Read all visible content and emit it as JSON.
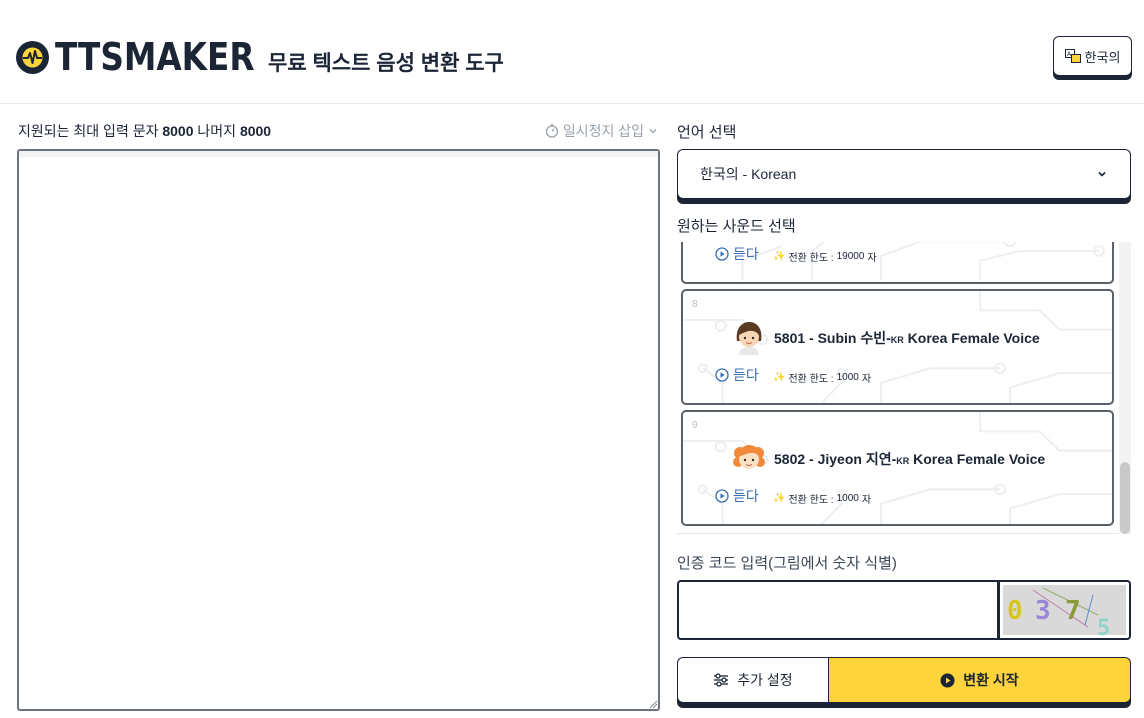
{
  "header": {
    "logo_text": "TTSMAKER",
    "tagline": "무료 텍스트 음성 변환 도구",
    "language_button": "한국의"
  },
  "editor": {
    "stats_prefix": "지원되는 최대 입력 문자",
    "max_chars": "8000",
    "remaining_label": "나머지",
    "remaining_chars": "8000",
    "pause_insert": "일시정지 삽입",
    "text_value": ""
  },
  "language": {
    "label": "언어 선택",
    "selected": "한국의 - Korean"
  },
  "voices": {
    "label": "원하는 사운드 선택",
    "listen_label": "듣다",
    "limit_prefix": "전환 한도 :",
    "limit_unit": "자",
    "items": [
      {
        "index": "",
        "name": "",
        "tag": "",
        "suffix": "",
        "limit": "19000"
      },
      {
        "index": "8",
        "name": "5801 - Subin 수빈-",
        "tag": "KR",
        "suffix": " Korea Female Voice",
        "limit": "1000"
      },
      {
        "index": "9",
        "name": "5802 - Jiyeon 지연-",
        "tag": "KR",
        "suffix": " Korea Female Voice",
        "limit": "1000"
      }
    ]
  },
  "captcha": {
    "label": "인증 코드 입력(그림에서 숫자 식별)",
    "value": "",
    "digits": [
      "0",
      "3",
      "7",
      "5"
    ],
    "digit_colors": [
      "#d6c51a",
      "#9a86d8",
      "#8a9a3a",
      "#8fd3c8"
    ]
  },
  "actions": {
    "more_settings": "추가 설정",
    "convert": "변환 시작"
  },
  "colors": {
    "navy": "#1b2535",
    "accent_yellow": "#fdd43b",
    "link_blue": "#3a6fb0"
  }
}
